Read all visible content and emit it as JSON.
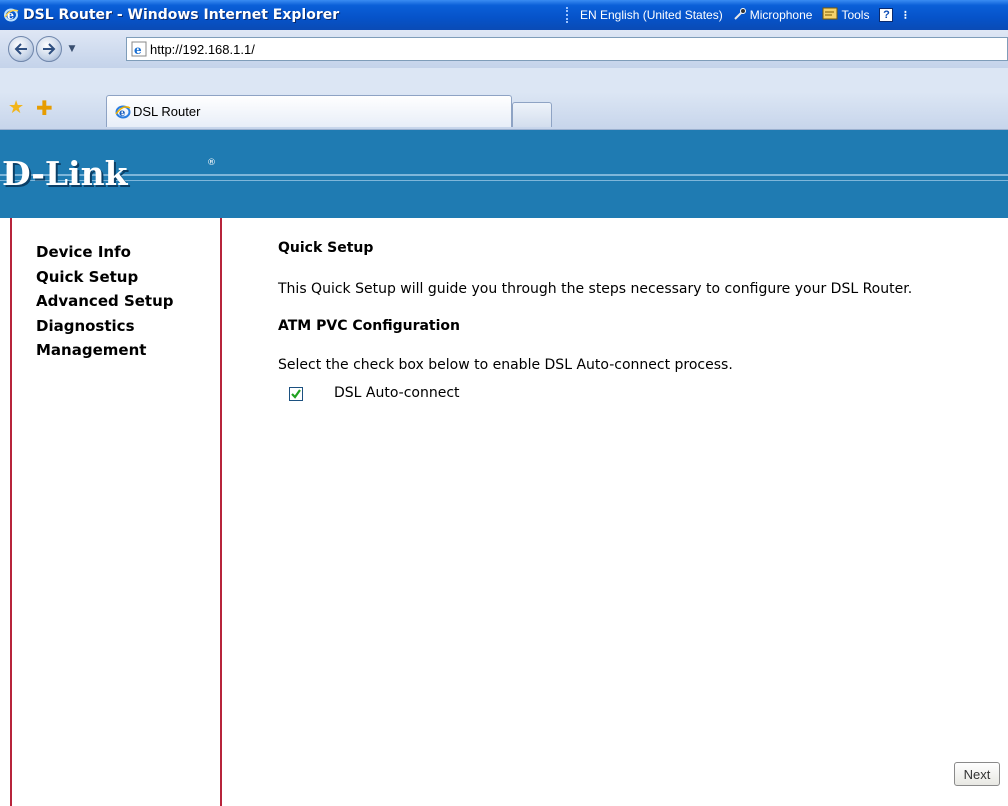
{
  "window": {
    "title": "DSL Router - Windows Internet Explorer"
  },
  "language_bar": {
    "language": "EN English (United States)",
    "microphone": "Microphone",
    "tools": "Tools",
    "help": "?"
  },
  "address_bar": {
    "url": "http://192.168.1.1/"
  },
  "tabs": [
    {
      "label": "DSL Router",
      "active": true
    }
  ],
  "banner": {
    "logo": "D-Link",
    "registered_mark": "®"
  },
  "sidebar": {
    "items": [
      {
        "label": "Device Info"
      },
      {
        "label": "Quick Setup"
      },
      {
        "label": "Advanced Setup"
      },
      {
        "label": "Diagnostics"
      },
      {
        "label": "Management"
      }
    ]
  },
  "main": {
    "title": "Quick Setup",
    "description": "This Quick Setup will guide you through the steps necessary to configure your DSL Router.",
    "section_title": "ATM PVC Configuration",
    "instruction": "Select the check box below to enable DSL Auto-connect process.",
    "auto_connect": {
      "label": "DSL Auto-connect",
      "checked": true
    },
    "next_label": "Next"
  },
  "colors": {
    "titlebar": "#0653c9",
    "banner": "#1f7bb2",
    "sidebar_border": "#b7243b"
  }
}
